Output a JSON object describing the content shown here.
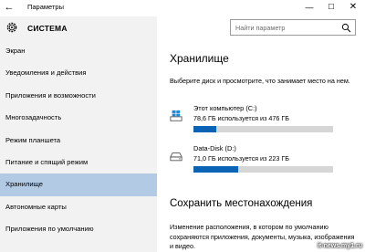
{
  "window": {
    "title": "Параметры",
    "back_glyph": "←",
    "minimize_glyph": "—",
    "maximize_glyph": "☐",
    "close_glyph": "✕"
  },
  "sidebar": {
    "section_title": "СИСТЕМА",
    "section_icon": "gear-icon",
    "items": [
      {
        "label": "Экран",
        "active": false
      },
      {
        "label": "Уведомления и действия",
        "active": false
      },
      {
        "label": "Приложения и возможности",
        "active": false
      },
      {
        "label": "Многозадачность",
        "active": false
      },
      {
        "label": "Режим планшета",
        "active": false
      },
      {
        "label": "Питание и спящий режим",
        "active": false
      },
      {
        "label": "Хранилище",
        "active": true
      },
      {
        "label": "Автономные карты",
        "active": false
      },
      {
        "label": "Приложения по умолчанию",
        "active": false
      }
    ]
  },
  "search": {
    "placeholder": "Найти параметр",
    "icon": "search-icon"
  },
  "main": {
    "title": "Хранилище",
    "description": "Выберите диск и просмотрите, что занимает место на нем.",
    "drives": [
      {
        "name": "Этот компьютер (C:)",
        "info": "78,6 ГБ используется из 476 ГБ",
        "used_fraction": 0.165,
        "icon": "windows-drive-icon"
      },
      {
        "name": "Data-Disk (D:)",
        "info": "71,0 ГБ используется из 223 ГБ",
        "used_fraction": 0.318,
        "icon": "hard-drive-icon"
      }
    ],
    "save_locations_title": "Сохранить местонахождения",
    "save_locations_description": "Изменение расположения, в котором по умолчанию сохраняются приложения, документы, музыка, изображения и видео."
  },
  "colors": {
    "accent": "#0b63b5",
    "sidebar_bg": "#f2f2f2",
    "active_item_bg": "#b2cae4",
    "bar_bg": "#d6d6d6"
  },
  "watermark": "it-news.my1.ru"
}
